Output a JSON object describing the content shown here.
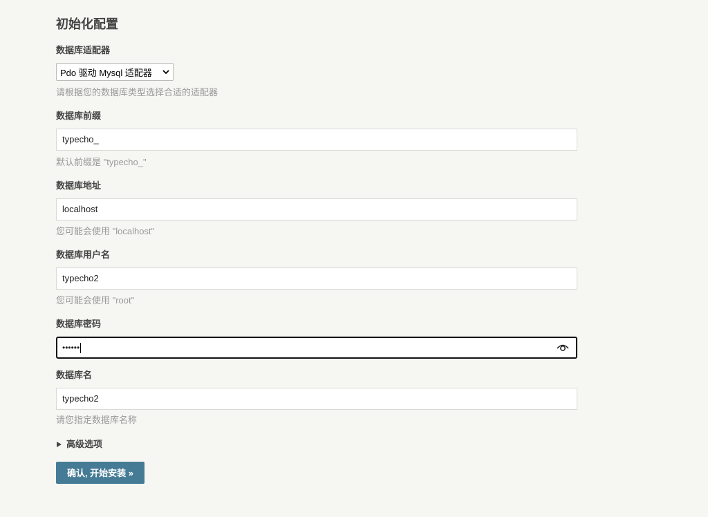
{
  "page": {
    "title": "初始化配置"
  },
  "adapter": {
    "label": "数据库适配器",
    "selected": "Pdo 驱动 Mysql 适配器",
    "hint": "请根据您的数据库类型选择合适的适配器"
  },
  "prefix": {
    "label": "数据库前缀",
    "value": "typecho_",
    "hint": "默认前缀是 \"typecho_\""
  },
  "host": {
    "label": "数据库地址",
    "value": "localhost",
    "hint": "您可能会使用 \"localhost\""
  },
  "user": {
    "label": "数据库用户名",
    "value": "typecho2",
    "hint": "您可能会使用 \"root\""
  },
  "password": {
    "label": "数据库密码",
    "masked_value": "••••••",
    "icon": "eye-icon"
  },
  "dbname": {
    "label": "数据库名",
    "value": "typecho2",
    "hint": "请您指定数据库名称"
  },
  "advanced": {
    "label": "高级选项"
  },
  "submit": {
    "label": "确认, 开始安装 »"
  },
  "colors": {
    "background": "#f6f6f3",
    "button": "#467b96",
    "hint": "#999999",
    "label": "#444444"
  }
}
